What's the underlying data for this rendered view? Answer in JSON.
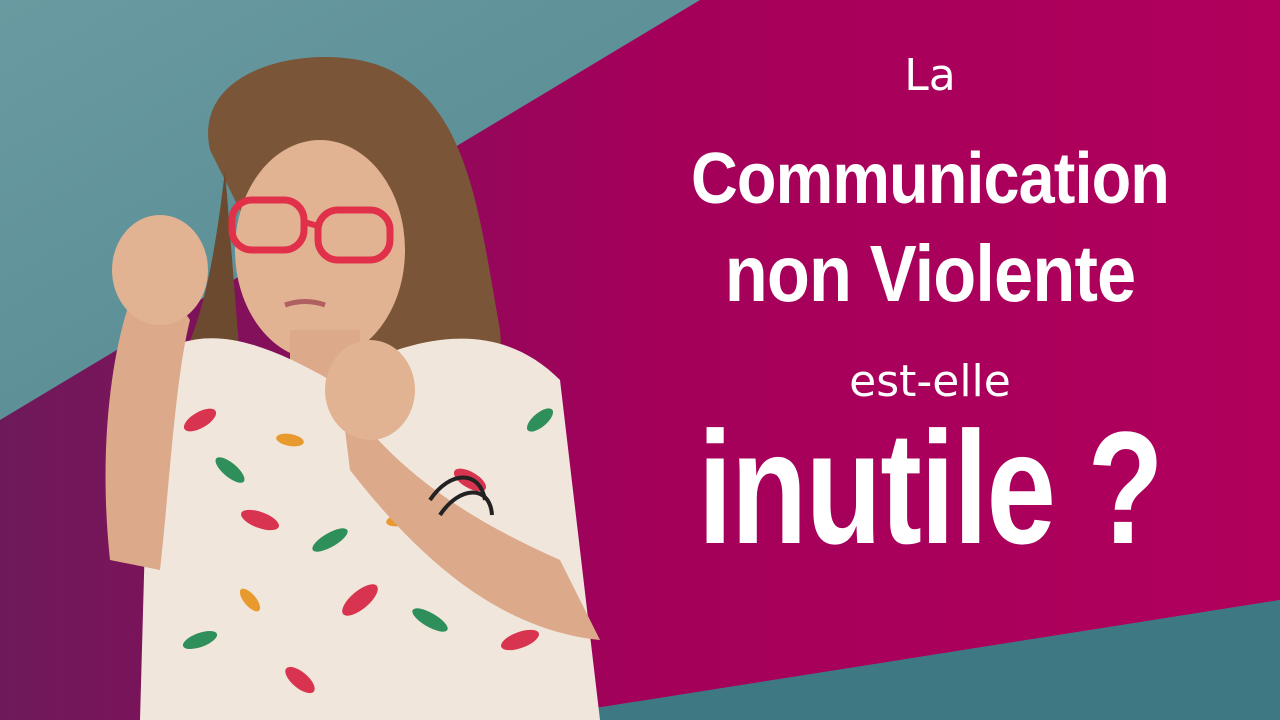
{
  "headline": {
    "line1": "La",
    "line2": "Communication",
    "line3": "non Violente",
    "line4": "est-elle",
    "line5": "inutile ?"
  },
  "colors": {
    "teal": "#5a8c95",
    "magenta": "#a8005a",
    "purple": "#7a1a5c",
    "text": "#ffffff"
  },
  "photo": {
    "subject": "woman-in-boxing-pose"
  }
}
